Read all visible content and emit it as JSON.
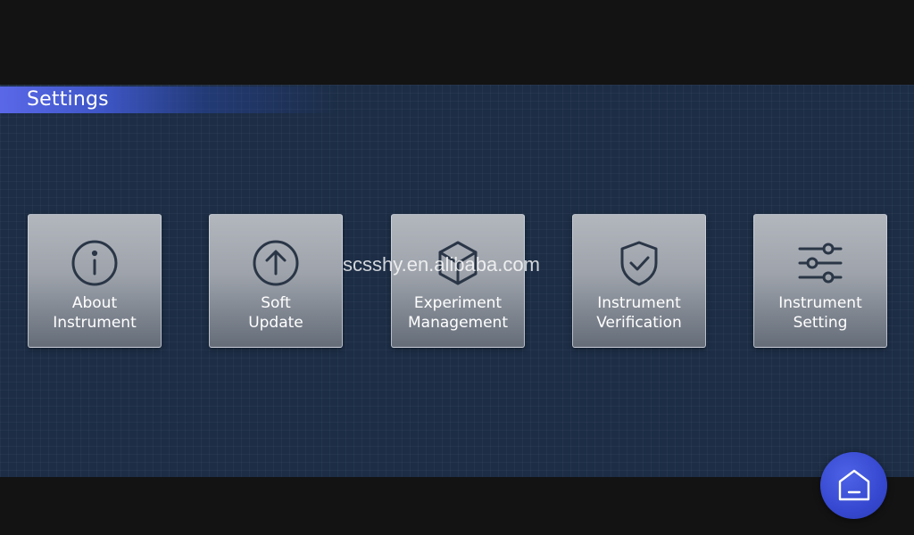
{
  "header": {
    "title": "Settings"
  },
  "tiles": [
    {
      "line1": "About",
      "line2": "Instrument",
      "icon": "info-icon"
    },
    {
      "line1": "Soft",
      "line2": "Update",
      "icon": "upload-arrow-icon"
    },
    {
      "line1": "Experiment",
      "line2": "Management",
      "icon": "cube-icon"
    },
    {
      "line1": "Instrument",
      "line2": "Verification",
      "icon": "shield-check-icon"
    },
    {
      "line1": "Instrument",
      "line2": "Setting",
      "icon": "sliders-icon"
    }
  ],
  "watermark": "scsshy.en.alibaba.com",
  "home": {
    "icon": "home-icon"
  },
  "colors": {
    "panel": "#1c2d45",
    "accent": "#3e56c7",
    "tile_top": "#b2b6bd",
    "tile_bottom": "#656d79",
    "icon_stroke": "#2a3646"
  }
}
